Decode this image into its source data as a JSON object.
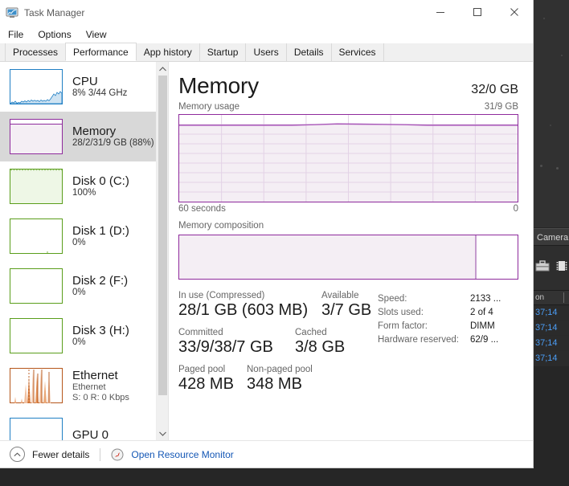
{
  "window": {
    "title": "Task Manager",
    "icon": "task-manager-icon",
    "minimize": "–",
    "maximize": "□",
    "close": "✕"
  },
  "menu": {
    "items": [
      "File",
      "Options",
      "View"
    ]
  },
  "tabs": {
    "items": [
      "Processes",
      "Performance",
      "App history",
      "Startup",
      "Users",
      "Details",
      "Services"
    ],
    "active": "Performance"
  },
  "sidebar": {
    "scroll_up": "ⱏ",
    "scroll_down": "ⱟ",
    "items": [
      {
        "name": "CPU",
        "title": "CPU",
        "sub": "8%  3/44 GHz",
        "sub2": "",
        "color": "#1f7fc4",
        "selected": false
      },
      {
        "name": "Memory",
        "title": "Memory",
        "sub": "28/2/31/9 GB (88%)",
        "sub2": "",
        "color": "#8e2a9c",
        "selected": true
      },
      {
        "name": "Disk 0 (C:)",
        "title": "Disk 0 (C:)",
        "sub": "100%",
        "sub2": "",
        "color": "#5a9e1b",
        "selected": false
      },
      {
        "name": "Disk 1 (D:)",
        "title": "Disk 1 (D:)",
        "sub": "0%",
        "sub2": "",
        "color": "#5a9e1b",
        "selected": false
      },
      {
        "name": "Disk 2 (F:)",
        "title": "Disk 2 (F:)",
        "sub": "0%",
        "sub2": "",
        "color": "#5a9e1b",
        "selected": false
      },
      {
        "name": "Disk 3 (H:)",
        "title": "Disk 3 (H:)",
        "sub": "0%",
        "sub2": "",
        "color": "#5a9e1b",
        "selected": false
      },
      {
        "name": "Ethernet",
        "title": "Ethernet",
        "sub": "Ethernet",
        "sub2": "S: 0 R: 0 Kbps",
        "color": "#b5561a",
        "selected": false
      },
      {
        "name": "GPU 0",
        "title": "GPU 0",
        "sub": "",
        "sub2": "",
        "color": "#1f7fc4",
        "selected": false
      }
    ]
  },
  "main": {
    "title": "Memory",
    "total": "32/0 GB",
    "usage_label": "Memory usage",
    "usage_max": "31/9 GB",
    "axis_left": "60 seconds",
    "axis_right": "0",
    "composition_label": "Memory composition",
    "stats_left": [
      {
        "label": "In use (Compressed)",
        "value": "28/1 GB (603 MB)"
      },
      {
        "label": "Available",
        "value": "3/7 GB"
      },
      {
        "label": "Committed",
        "value": "33/9/38/7 GB"
      },
      {
        "label": "Cached",
        "value": "3/8 GB"
      },
      {
        "label": "Paged pool",
        "value": "428 MB"
      },
      {
        "label": "Non-paged pool",
        "value": "348 MB"
      }
    ],
    "stats_right": [
      {
        "key": "Speed:",
        "value": "2133 ..."
      },
      {
        "key": "Slots used:",
        "value": "2 of 4"
      },
      {
        "key": "Form factor:",
        "value": "DIMM"
      },
      {
        "key": "Hardware reserved:",
        "value": "62/9 ..."
      }
    ]
  },
  "footer": {
    "fewer_details": "Fewer details",
    "fewer_icon": "chevron-up-circle-icon",
    "resource_monitor": "Open Resource Monitor",
    "resource_icon": "resource-monitor-icon"
  },
  "background": {
    "camera_label": "Camera",
    "column_header": "on",
    "rows": [
      "37;14",
      "37;14",
      "37;14",
      "37;14"
    ]
  },
  "chart_data": {
    "type": "area",
    "title": "Memory usage",
    "xlabel": "60 seconds",
    "ylabel": "Memory",
    "ylim": [
      0,
      31.9
    ],
    "xlim": [
      60,
      0
    ],
    "grid": true,
    "accent": "#8e2a9c",
    "fill": "#f4eef4",
    "x": [
      0,
      4,
      8,
      12,
      16,
      20,
      24,
      28,
      32,
      36,
      40,
      44,
      48,
      52,
      56,
      60
    ],
    "values": [
      28.1,
      28.1,
      28.1,
      28.1,
      28.1,
      28.1,
      28.3,
      28.6,
      28.5,
      28.4,
      28.3,
      28.1,
      28.1,
      28.1,
      28.1,
      28.1
    ],
    "composition": {
      "in_use_pct": 88,
      "available_pct": 12
    }
  }
}
